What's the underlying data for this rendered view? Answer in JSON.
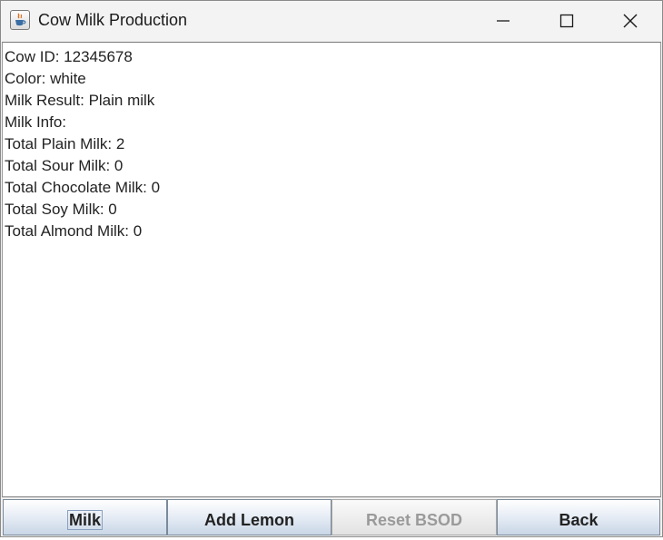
{
  "window": {
    "title": "Cow Milk Production",
    "icon": "java-coffee-cup-icon",
    "controls": [
      "minimize-icon",
      "maximize-icon",
      "close-icon"
    ]
  },
  "info_lines": [
    "Cow ID: 12345678",
    "Color: white",
    "Milk Result: Plain milk",
    "Milk Info:",
    "Total Plain Milk: 2",
    "Total Sour Milk: 0",
    "Total Chocolate Milk: 0",
    "Total Soy Milk: 0",
    "Total Almond Milk: 0"
  ],
  "buttons": {
    "milk": "Milk",
    "add_lemon": "Add Lemon",
    "reset_bsod": "Reset BSOD",
    "back": "Back"
  },
  "states": {
    "reset_bsod_enabled": false,
    "focused_button": "Milk"
  }
}
